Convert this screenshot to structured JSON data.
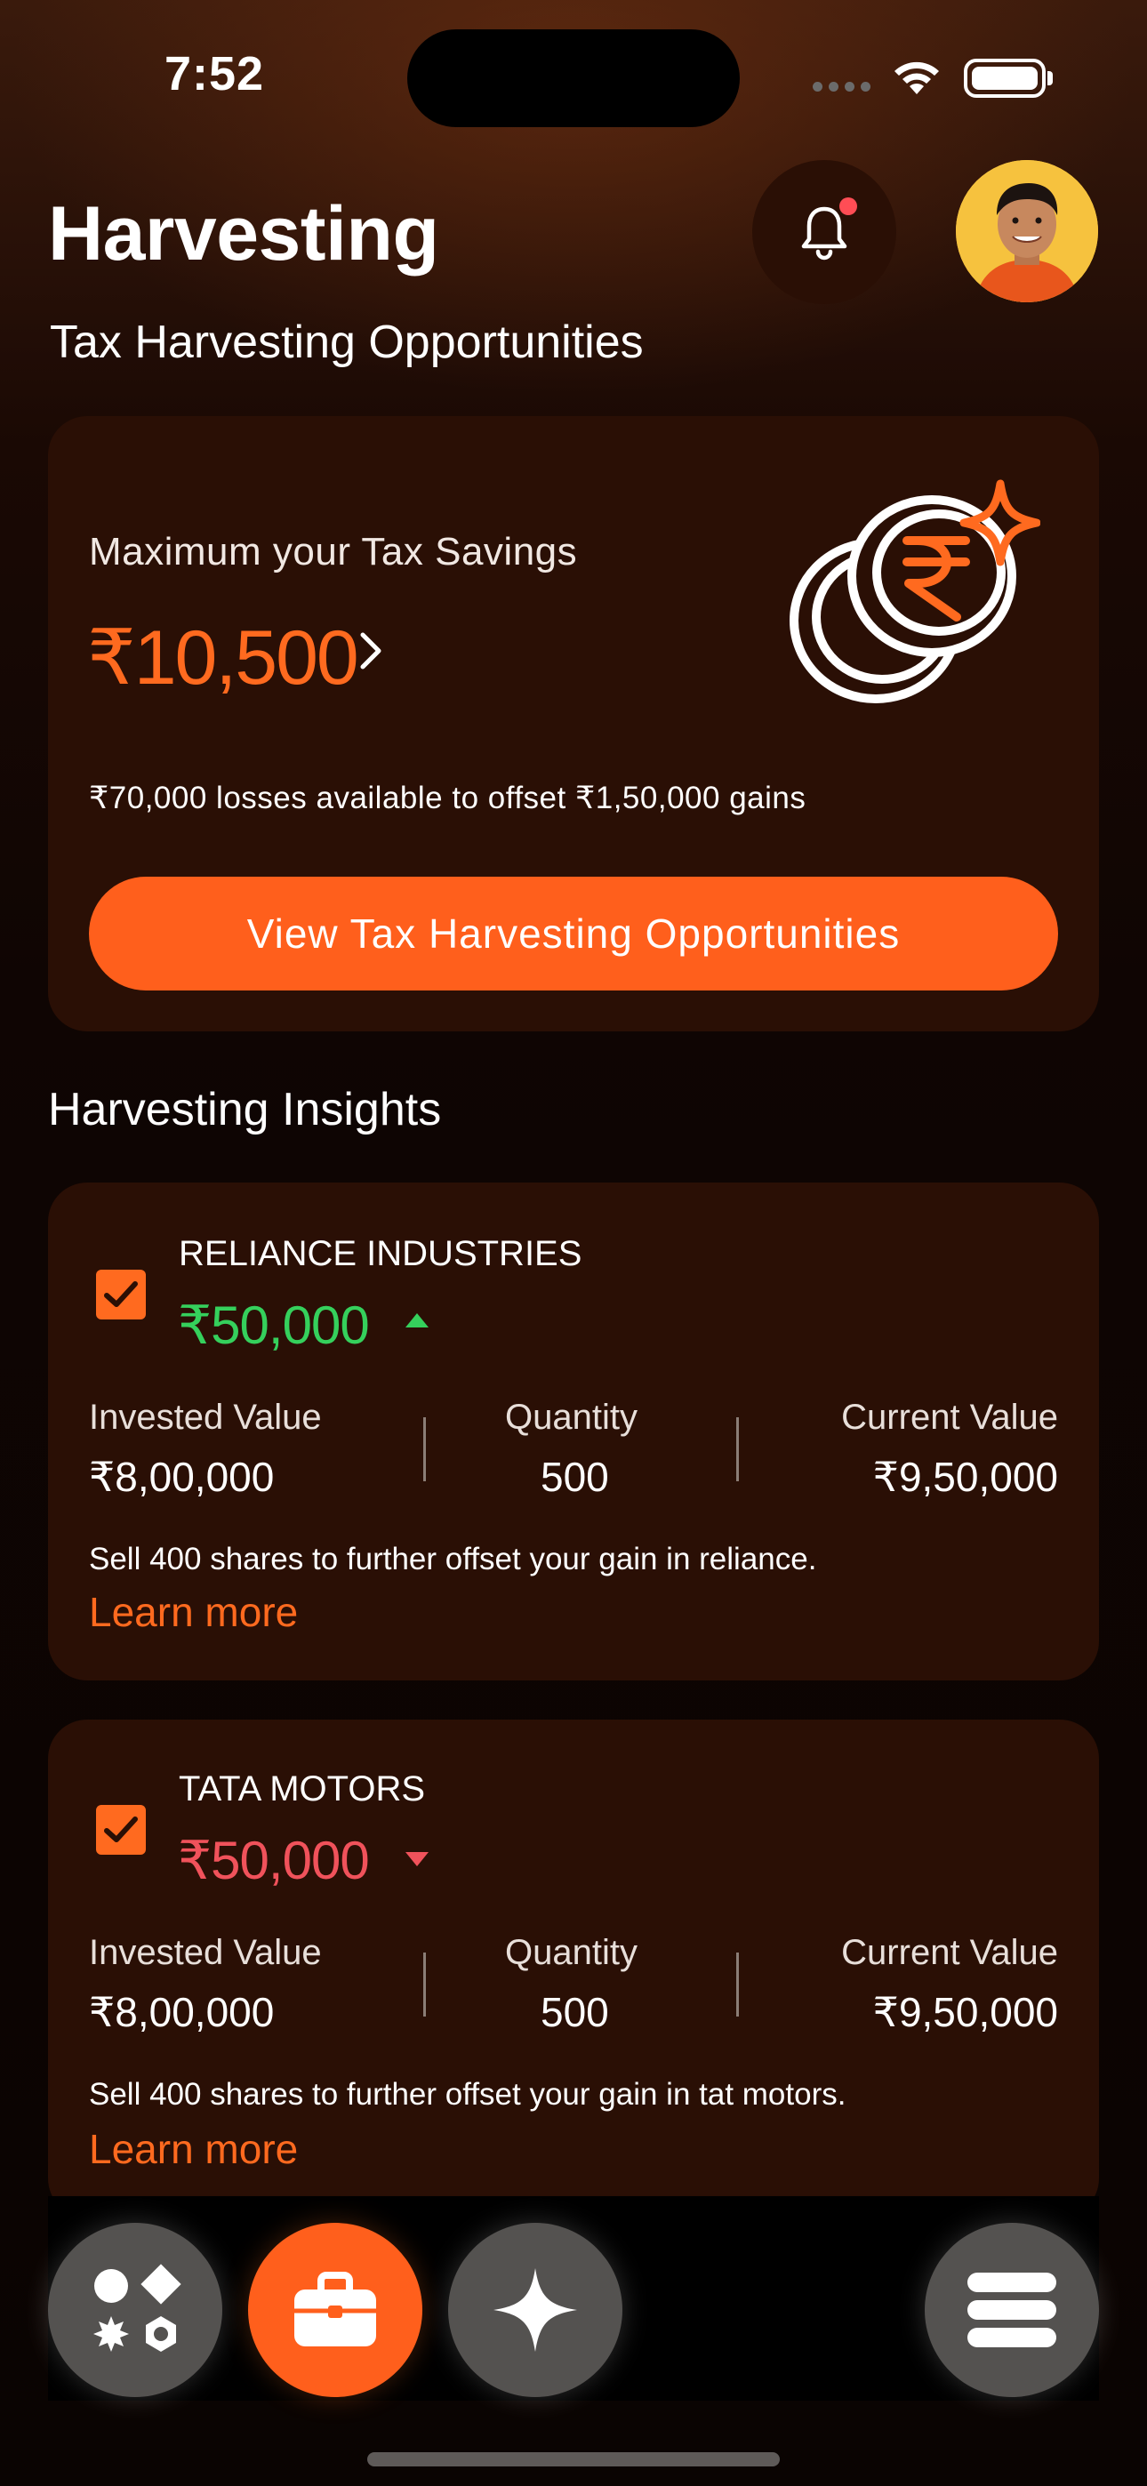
{
  "status_bar": {
    "time": "7:52"
  },
  "header": {
    "title": "Harvesting",
    "subtitle": "Tax Harvesting Opportunities"
  },
  "summary": {
    "label": "Maximum your Tax Savings",
    "amount": "₹10,500",
    "description": "₹70,000 losses available to offset ₹1,50,000 gains",
    "cta_label": "View Tax Harvesting Opportunities"
  },
  "insights": {
    "title": "Harvesting Insights",
    "labels": {
      "invested": "Invested Value",
      "quantity": "Quantity",
      "current": "Current Value",
      "learn_more": "Learn more"
    },
    "items": [
      {
        "name": "RELIANCE INDUSTRIES",
        "amount": "₹50,000",
        "trend": "up",
        "checked": true,
        "invested_value": "₹8,00,000",
        "quantity": "500",
        "current_value": "₹9,50,000",
        "description": "Sell 400 shares to further offset your gain in reliance."
      },
      {
        "name": "TATA MOTORS",
        "amount": "₹50,000",
        "trend": "down",
        "checked": true,
        "invested_value": "₹8,00,000",
        "quantity": "500",
        "current_value": "₹9,50,000",
        "description": "Sell 400 shares to further offset your gain in tat motors."
      }
    ]
  },
  "bottom_nav": {
    "items": [
      {
        "icon": "apps-shapes-icon",
        "active": false
      },
      {
        "icon": "briefcase-icon",
        "active": true
      },
      {
        "icon": "sparkle-icon",
        "active": false
      },
      {
        "icon": "menu-icon",
        "active": false
      }
    ]
  },
  "colors": {
    "accent": "#ff5f1c",
    "gain": "#35d05c",
    "loss": "#f0525b",
    "card": "#2a0f05"
  }
}
